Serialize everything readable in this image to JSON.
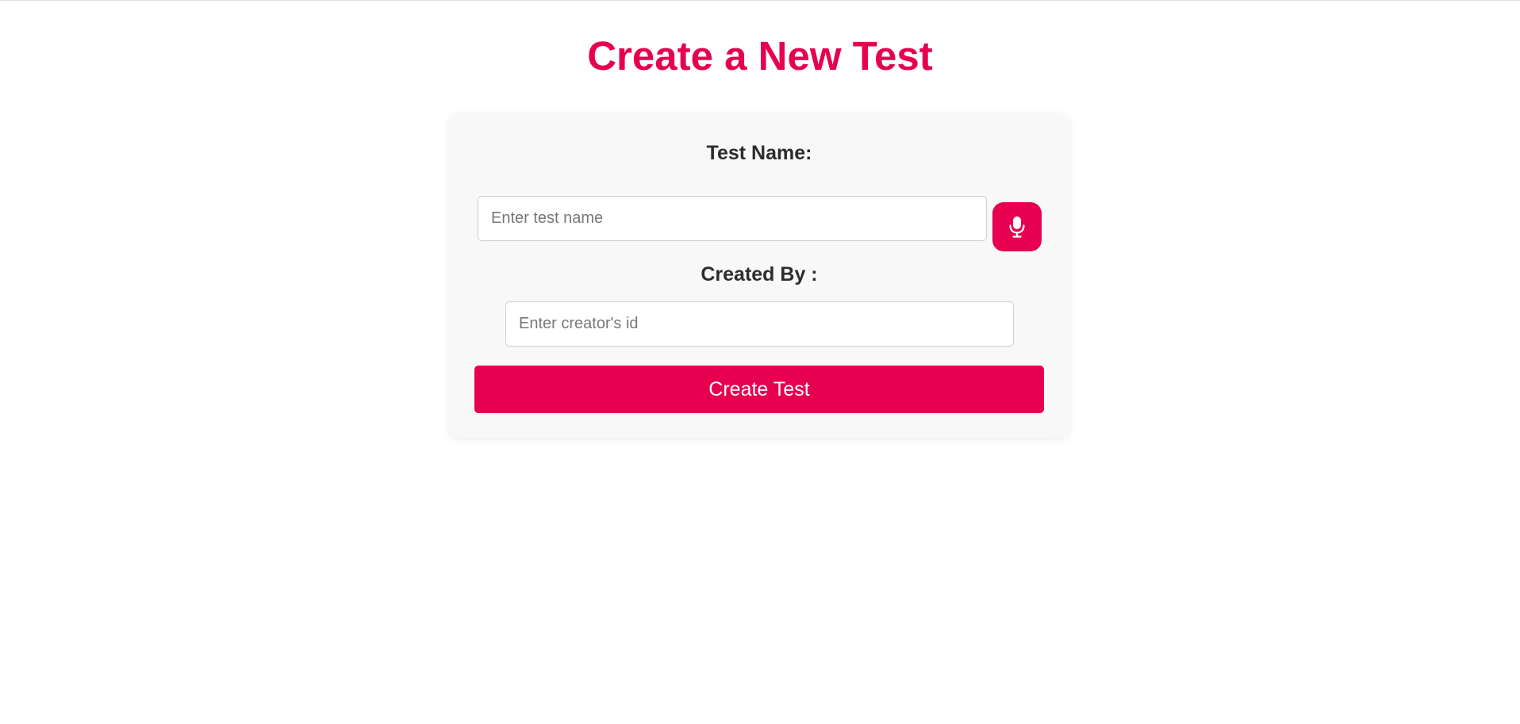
{
  "page": {
    "title": "Create a New Test"
  },
  "form": {
    "test_name_label": "Test Name:",
    "test_name_placeholder": "Enter test name",
    "test_name_value": "",
    "created_by_label": "Created By :",
    "created_by_placeholder": "Enter creator's id",
    "created_by_value": "",
    "mic_icon": "microphone-icon",
    "submit_label": "Create Test"
  },
  "colors": {
    "accent": "#e6004f",
    "card_background": "#f8f8f8",
    "label_text": "#2c2c2c"
  }
}
